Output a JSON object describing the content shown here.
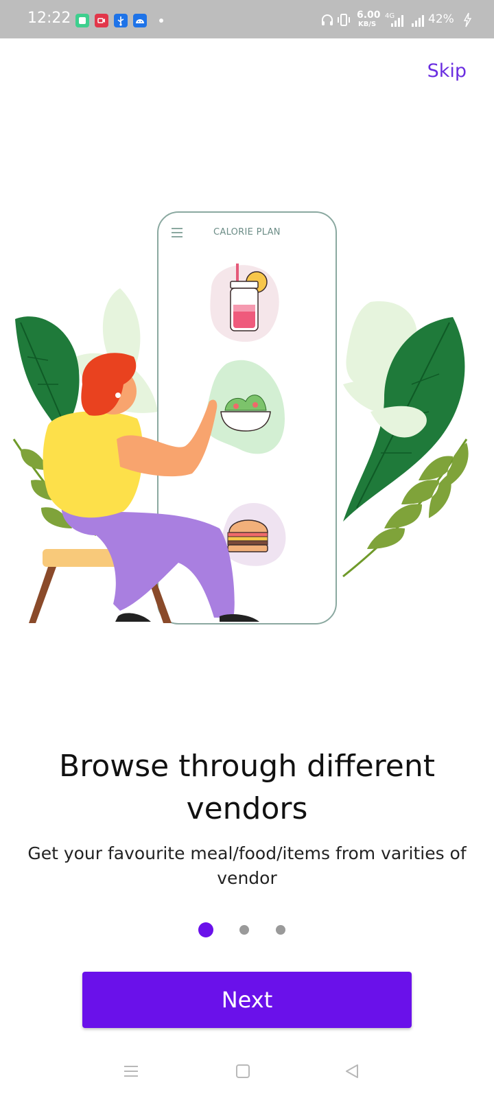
{
  "status_bar": {
    "time": "12:22",
    "speed_value": "6.00",
    "speed_unit": "KB/S",
    "network_label": "4G",
    "battery": "42%"
  },
  "onboarding": {
    "skip_label": "Skip",
    "illustration": {
      "phone_title": "CALORIE PLAN"
    },
    "headline": "Browse through different vendors",
    "subline": "Get your favourite meal/food/items from varities of vendor",
    "pages": {
      "current": 1,
      "total": 3
    },
    "next_label": "Next"
  },
  "colors": {
    "accent": "#6a11ea",
    "skip": "#6a2de0",
    "status_bar_bg": "#bdbdbd"
  },
  "icons": {
    "status_apps": [
      "notes-app-icon",
      "screen-record-icon",
      "usb-icon",
      "android-icon"
    ],
    "status_right": [
      "headphones-icon",
      "vibrate-icon",
      "signal-icon",
      "battery-charging-icon"
    ],
    "nav": [
      "recents-icon",
      "home-icon",
      "back-icon"
    ]
  }
}
